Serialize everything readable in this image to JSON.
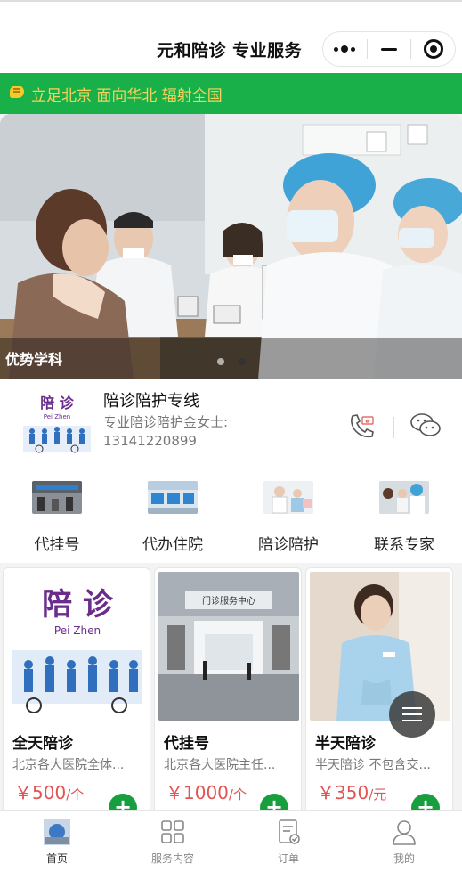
{
  "navbar": {
    "title": "元和陪诊 专业服务",
    "capsule_icons": [
      "more-icon",
      "minimize-icon",
      "close-target-icon"
    ]
  },
  "notice": {
    "icon": "speaker-icon",
    "text": "立足北京 面向华北 辐射全国"
  },
  "banner": {
    "caption": "优势学科",
    "slide_count": 2,
    "active_slide": 2
  },
  "contact": {
    "logo_text": "陪 诊",
    "logo_pinyin": "Pei Zhen",
    "title": "陪诊陪护专线",
    "subtitle": "专业陪诊陪护金女士:",
    "phone": "13141220899",
    "icons": [
      "phone-icon",
      "wechat-icon"
    ]
  },
  "menu": [
    {
      "label": "代挂号"
    },
    {
      "label": "代办住院"
    },
    {
      "label": "陪诊陪护"
    },
    {
      "label": "联系专家"
    }
  ],
  "products": [
    {
      "title": "全天陪诊",
      "desc": "北京各大医院全体...",
      "price": "￥500",
      "unit": "/个",
      "add": "+"
    },
    {
      "title": "代挂号",
      "desc": "北京各大医院主任...",
      "price": "￥1000",
      "unit": "/个",
      "add": "+"
    },
    {
      "title": "半天陪诊",
      "desc": "半天陪诊 不包含交...",
      "price": "￥350",
      "unit": "/元",
      "add": "+"
    }
  ],
  "card_images": {
    "logo_text": "陪 诊",
    "logo_pinyin": "Pei  Zhen",
    "hall_sign": "门诊服务中心"
  },
  "tabs": [
    {
      "label": "首页",
      "active": true
    },
    {
      "label": "服务内容",
      "active": false
    },
    {
      "label": "订单",
      "active": false
    },
    {
      "label": "我的",
      "active": false
    }
  ],
  "colors": {
    "brand_green": "#19b04a",
    "notice_text": "#f6d25a",
    "price_red": "#e25454",
    "add_green": "#169f3c"
  }
}
